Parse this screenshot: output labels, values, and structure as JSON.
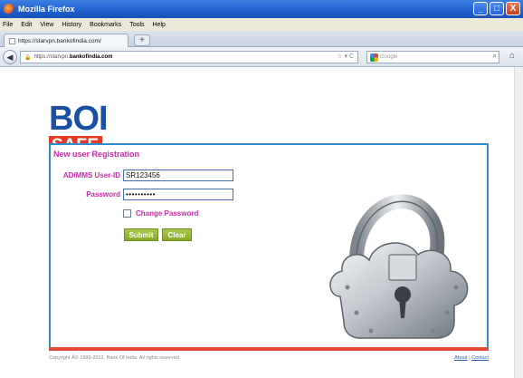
{
  "window": {
    "title": "Mozilla Firefox",
    "controls": {
      "minimize": "_",
      "maximize": "□",
      "close": "X"
    }
  },
  "menu": [
    "File",
    "Edit",
    "View",
    "History",
    "Bookmarks",
    "Tools",
    "Help"
  ],
  "tab": {
    "title": "https://starvpn.bankofindia.com/",
    "new_tab": "+"
  },
  "nav": {
    "url_prefix": "https://starvpn.",
    "url_domain": "bankofindia.com",
    "url_tools": "☆ ▾ C",
    "search_placeholder": "Google"
  },
  "logo": {
    "line1": "BOI",
    "line2": "SAFE"
  },
  "form": {
    "title": "New user Registration",
    "userid_label": "AD/MMS User-ID",
    "userid_value": "SR123456",
    "password_label": "Password",
    "password_value": "••••••••••",
    "change_password_label": "Change Password",
    "submit_label": "Submit",
    "clear_label": "Clear"
  },
  "footer": {
    "copyright": "Copyright Â© 1999-2012, Bank Of India. All rights reserved.",
    "about": "About",
    "separator": "|",
    "contact": "Contact"
  },
  "colors": {
    "brand_blue": "#1a4fa6",
    "brand_red": "#e33826",
    "label_magenta": "#cc2aa8",
    "button_green": "#99b93a",
    "panel_border": "#2e8ed0"
  }
}
